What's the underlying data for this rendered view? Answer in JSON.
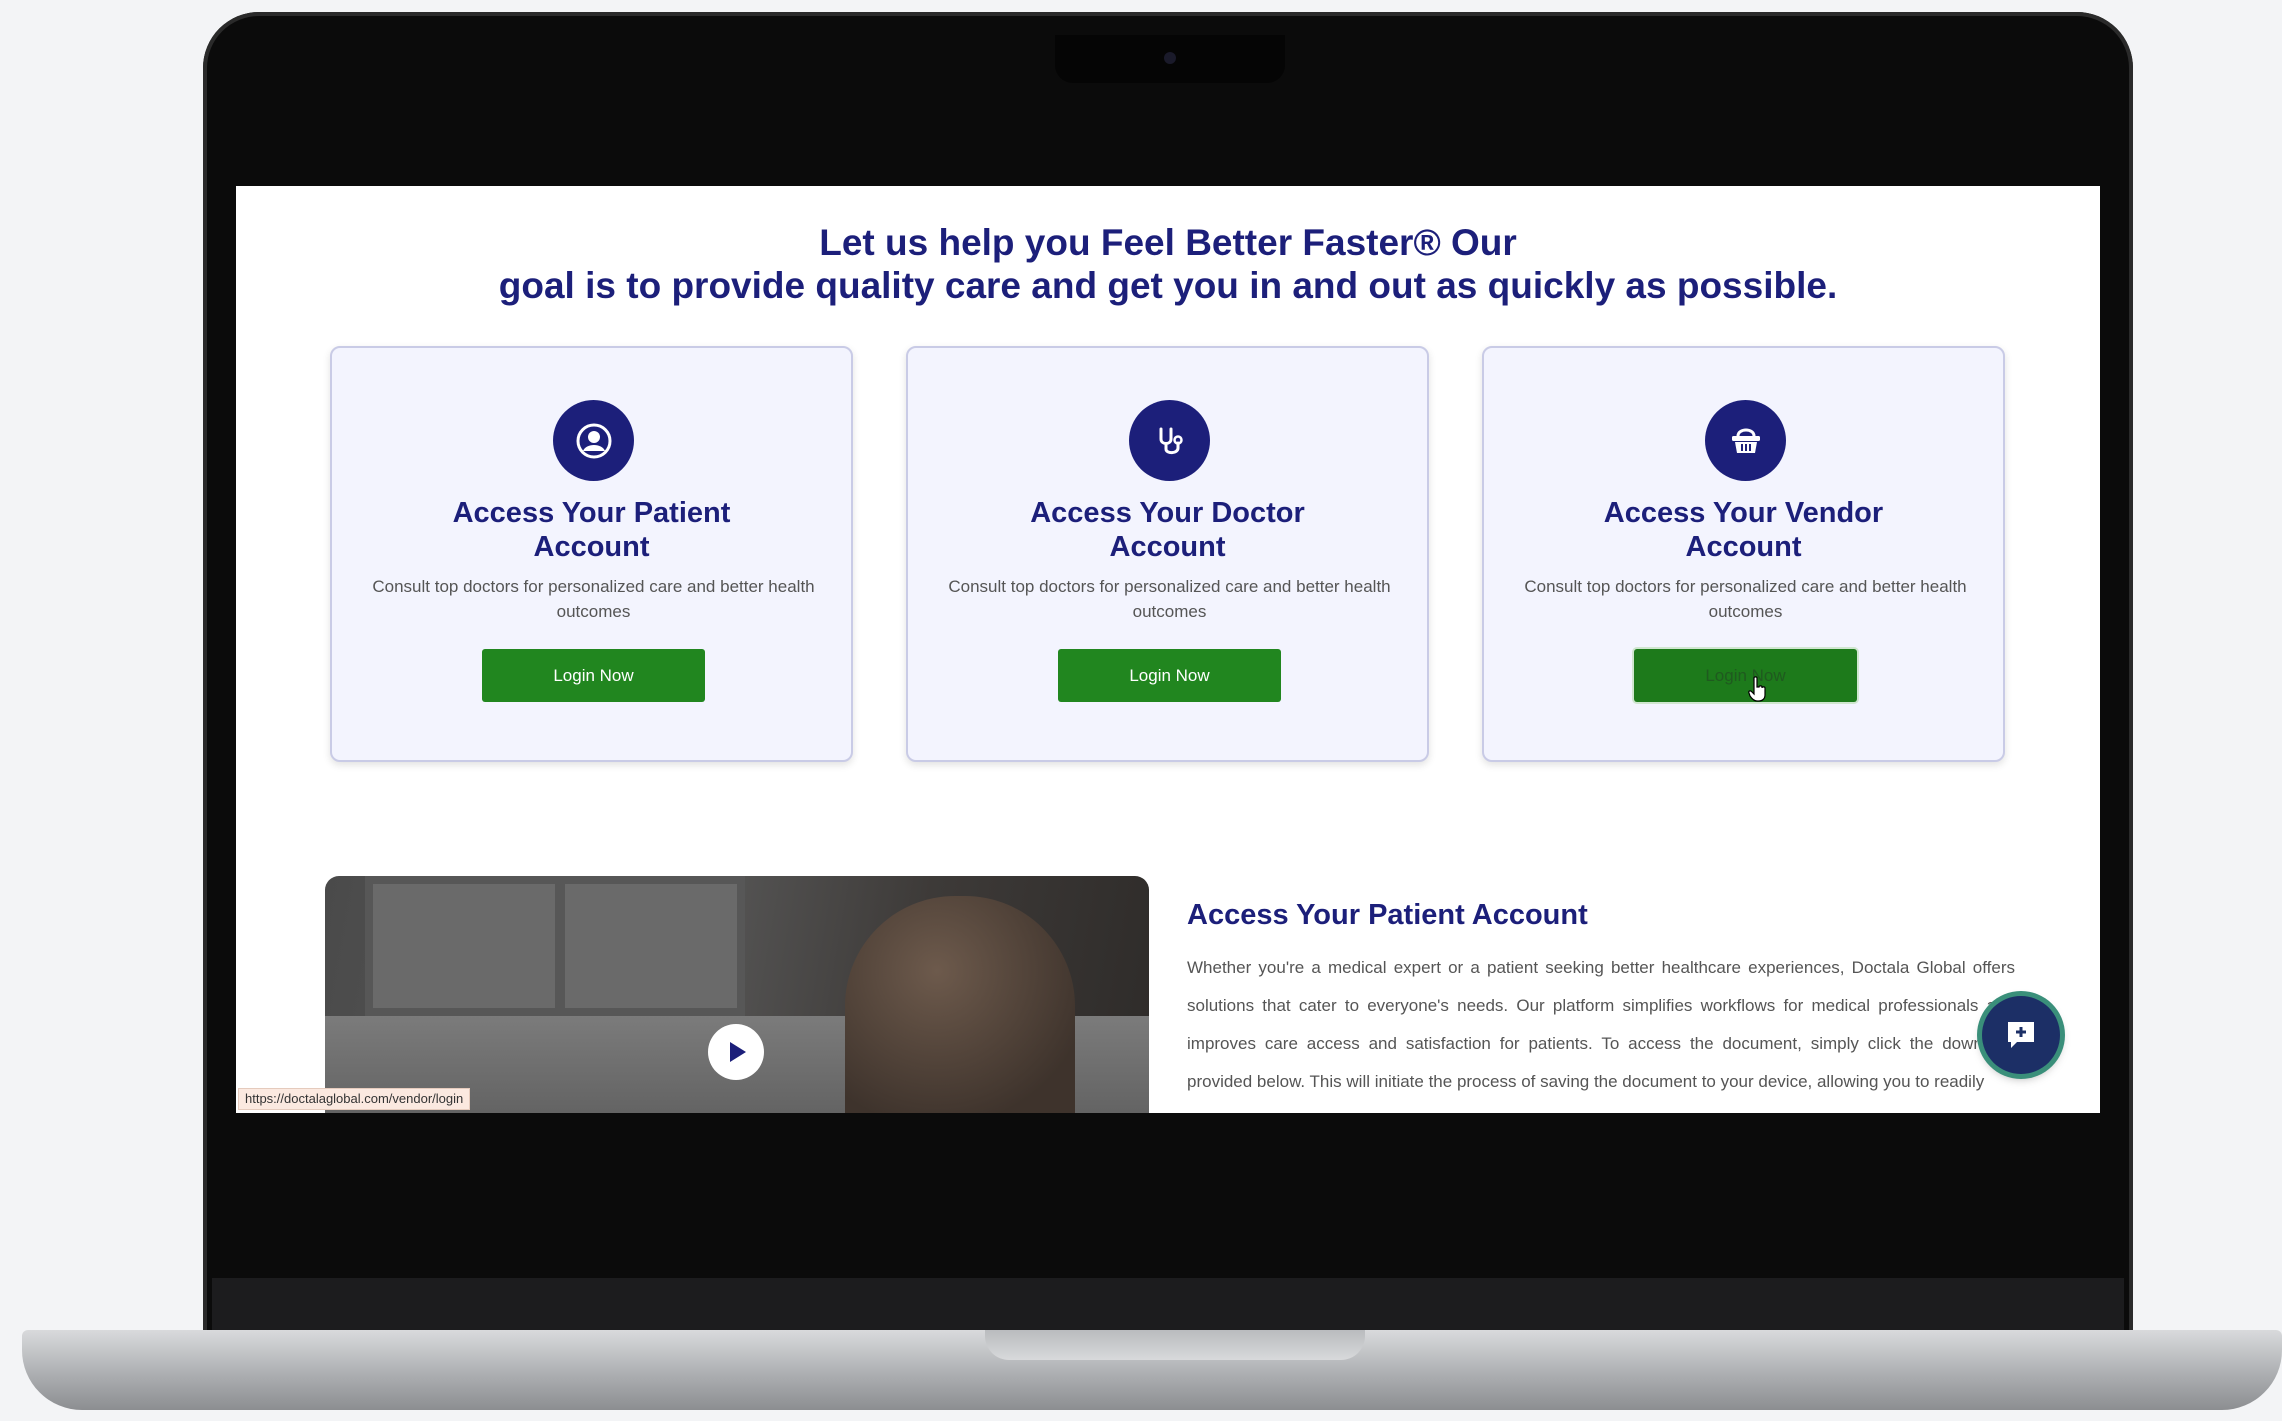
{
  "headline": {
    "line1": "Let us help you Feel Better Faster® Our",
    "line2": "goal is to provide quality care and get you in and out as quickly as possible."
  },
  "cards": [
    {
      "icon": "user-circle-icon",
      "title_line1": "Access Your Patient",
      "title_line2": "Account",
      "description": "Consult top doctors for personalized care and better health outcomes",
      "button_label": "Login Now"
    },
    {
      "icon": "stethoscope-icon",
      "title_line1": "Access Your Doctor",
      "title_line2": "Account",
      "description": "Consult top doctors for personalized care and better health outcomes",
      "button_label": "Login Now"
    },
    {
      "icon": "basket-icon",
      "title_line1": "Access Your Vendor",
      "title_line2": "Account",
      "description": "Consult top doctors for personalized care and better health outcomes",
      "button_label": "Login Now"
    }
  ],
  "video": {
    "play_icon": "play-icon"
  },
  "status_bar": {
    "url": "https://doctalaglobal.com/vendor/login"
  },
  "info": {
    "title": "Access Your Patient Account",
    "text": "Whether you're a medical expert or a patient seeking better healthcare experiences, Doctala Global offers solutions that cater to everyone's needs. Our platform simplifies workflows for medical professionals and improves care access and satisfaction for patients. To access the document, simply click the download provided below. This will initiate the process of saving the document to your device, allowing you to readily"
  },
  "chat": {
    "icon": "chat-plus-icon"
  },
  "colors": {
    "brand_navy": "#1c1f7a",
    "button_green": "#21861f",
    "card_bg": "#f3f4fe"
  }
}
